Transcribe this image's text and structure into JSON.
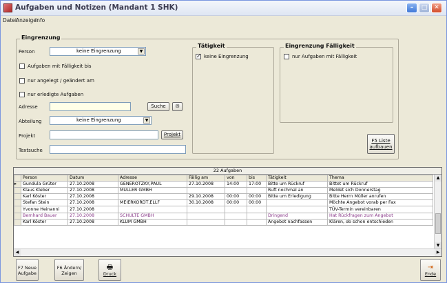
{
  "window": {
    "title": "Aufgaben und Notizen (Mandant 1 SHK)"
  },
  "menu": [
    "Datei",
    "Anzeige",
    "Info"
  ],
  "filter": {
    "group_title": "Eingrenzung",
    "person_label": "Person",
    "person_value": "keine Eingrenzung",
    "chk_faelligkeit": "Aufgaben mit Fälligkeit bis",
    "chk_angelegt": "nur angelegt / geändert am",
    "chk_erledigt": "nur erledigte Aufgaben",
    "adresse_label": "Adresse",
    "suche_button": "Suche",
    "abteilung_label": "Abteilung",
    "abteilung_value": "keine Eingrenzung",
    "projekt_label": "Projekt",
    "projekt_button": "Projekt",
    "textsuche_label": "Textsuche"
  },
  "taetigkeit": {
    "title": "Tätigkeit",
    "checkbox": "keine Eingrenzung"
  },
  "faelligkeit": {
    "title": "Eingrenzung Fälligkeit",
    "checkbox": "nur Aufgaben mit Fälligkeit"
  },
  "f5_button": {
    "line1": "F5 Liste",
    "line2": "aufbauen"
  },
  "grid": {
    "caption": "22 Aufgaben",
    "columns": [
      "Person",
      "Datum",
      "Adresse",
      "Fällig am",
      "von",
      "bis",
      "Tätigkeit",
      "Thema"
    ],
    "rows": [
      [
        "Gundula Grüter",
        "27.10.2008",
        "GENEROTZKY,PAUL",
        "27.10.2008",
        "14:00",
        "17:00",
        "Bitte um Rückruf",
        "Bittet um Rückruf"
      ],
      [
        "Klaus Kleber",
        "27.10.2008",
        "MÜLLER GMBH",
        "",
        "",
        "",
        "Ruft nochmal an",
        "Meldet sich Donnerstag"
      ],
      [
        "Karl Köster",
        "27.10.2008",
        "",
        "29.10.2008",
        "00:00",
        "00:00",
        "Bitte um Erledigung",
        "Bitte Herrn Müller anrufen"
      ],
      [
        "Stefan Stein",
        "27.10.2008",
        "MEIERKORDT,ELLF",
        "30.10.2008",
        "00:00",
        "00:00",
        "",
        "Möchte Angebot vorab per Fax"
      ],
      [
        "Yvonne Heinanni",
        "27.10.2008",
        "",
        "",
        "",
        "",
        "",
        "TÜV-Termin vereinbaren"
      ],
      [
        "Bernhard Bauer",
        "27.10.2008",
        "SCHULTE GMBH",
        "",
        "",
        "",
        "Dringend",
        "Hat Rückfragen zum Angebot"
      ],
      [
        "Karl Köster",
        "27.10.2008",
        "KLUM GMBH",
        "",
        "",
        "",
        "Angebot nachfassen",
        "Klären, ob schon entschieden"
      ]
    ]
  },
  "bottom": {
    "f7_line1": "F7 Neue",
    "f7_line2": "Aufgabe",
    "f6_line1": "F6 Ändern/",
    "f6_line2": "Zeigen",
    "druck": "Druck",
    "ende": "Ende"
  },
  "colors": {
    "highlight_row": "#8a3a8a",
    "window_bg": "#ece9d8"
  }
}
